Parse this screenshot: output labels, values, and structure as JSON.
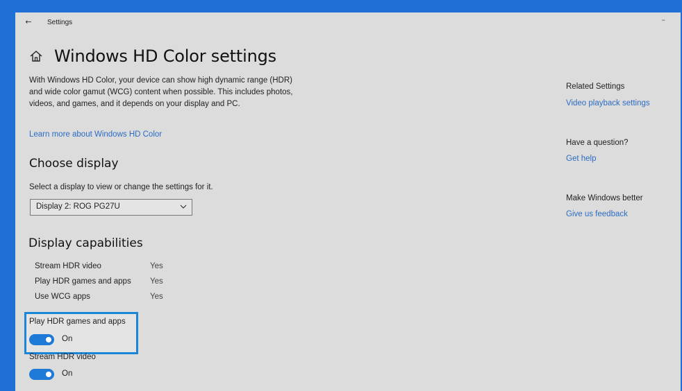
{
  "titlebar": {
    "back_glyph": "←",
    "title": "Settings",
    "minimize_glyph": "–"
  },
  "page": {
    "title": "Windows HD Color settings",
    "description": "With Windows HD Color, your device can show high dynamic range (HDR) and wide color gamut (WCG) content when possible. This includes photos, videos, and games, and it depends on your display and PC.",
    "learn_more": "Learn more about Windows HD Color"
  },
  "choose_display": {
    "heading": "Choose display",
    "label": "Select a display to view or change the settings for it.",
    "selected": "Display 2: ROG PG27U"
  },
  "capabilities": {
    "heading": "Display capabilities",
    "rows": [
      {
        "label": "Stream HDR video",
        "value": "Yes"
      },
      {
        "label": "Play HDR games and apps",
        "value": "Yes"
      },
      {
        "label": "Use WCG apps",
        "value": "Yes"
      }
    ]
  },
  "toggles": [
    {
      "label": "Play HDR games and apps",
      "state": "On",
      "on": true,
      "highlighted": true
    },
    {
      "label": "Stream HDR video",
      "state": "On",
      "on": true,
      "highlighted": false
    }
  ],
  "sidebar": {
    "related_heading": "Related Settings",
    "related_link": "Video playback settings",
    "question_heading": "Have a question?",
    "question_link": "Get help",
    "better_heading": "Make Windows better",
    "better_link": "Give us feedback"
  },
  "colors": {
    "accent": "#1e7ad6",
    "link": "#2b6cc4",
    "background": "#dcdcdc",
    "frame": "#1f6fd4"
  },
  "icons": [
    "back-arrow-icon",
    "home-icon",
    "chevron-down-icon"
  ]
}
